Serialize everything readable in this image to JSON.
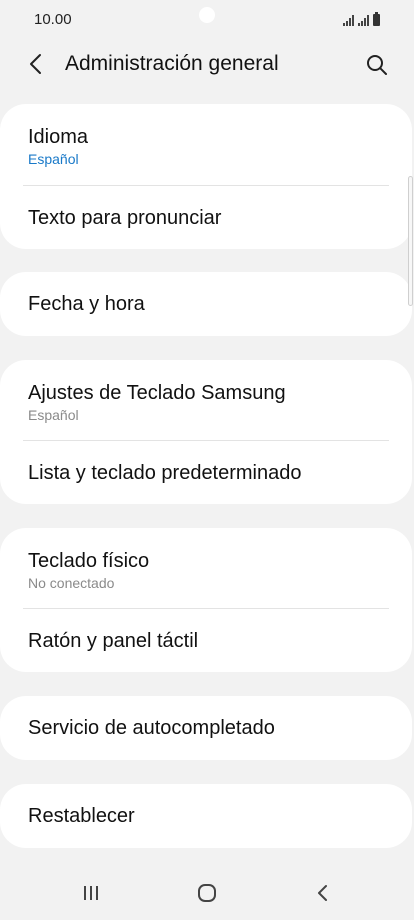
{
  "status_bar": {
    "time": "10.00"
  },
  "header": {
    "title": "Administración general",
    "back_icon": "chevron-left-icon",
    "search_icon": "search-icon"
  },
  "cards": [
    {
      "items": [
        {
          "title": "Idioma",
          "subtitle": "Español",
          "subtitle_color": "#1979c8"
        },
        {
          "title": "Texto para pronunciar"
        }
      ]
    },
    {
      "items": [
        {
          "title": "Fecha y hora"
        }
      ]
    },
    {
      "items": [
        {
          "title": "Ajustes de Teclado Samsung",
          "subtitle": "Español"
        },
        {
          "title": "Lista y teclado predeterminado"
        }
      ]
    },
    {
      "items": [
        {
          "title": "Teclado físico",
          "subtitle": "No conectado"
        },
        {
          "title": "Ratón y panel táctil"
        }
      ]
    },
    {
      "items": [
        {
          "title": "Servicio de autocompletado"
        }
      ]
    },
    {
      "items": [
        {
          "title": "Restablecer"
        }
      ]
    }
  ],
  "nav_bar": {
    "recents_icon": "recents-icon",
    "home_icon": "home-icon",
    "back_icon": "back-icon"
  }
}
